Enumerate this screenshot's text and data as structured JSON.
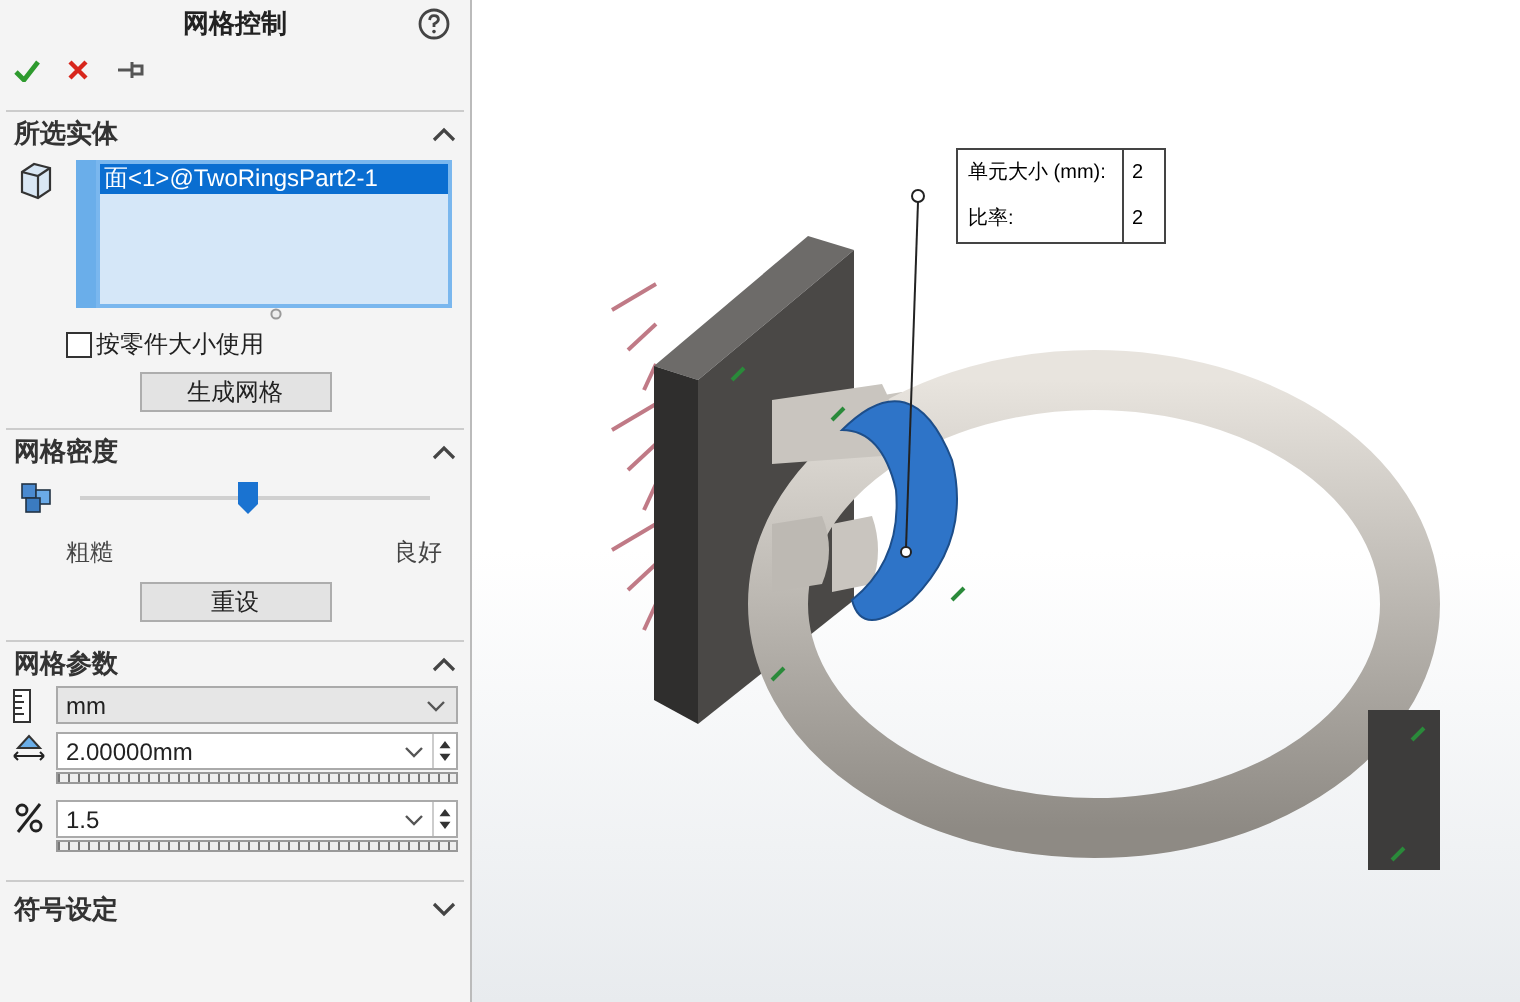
{
  "panel": {
    "title": "网格控制"
  },
  "selected_entities": {
    "title": "所选实体",
    "expanded": true,
    "items": [
      {
        "label": "面<1>@TwoRingsPart2-1",
        "selected": true
      }
    ],
    "checkbox": {
      "label": "按零件大小使用",
      "checked": false
    },
    "button": "生成网格"
  },
  "mesh_density": {
    "title": "网格密度",
    "expanded": true,
    "level": 0.48,
    "min_label": "粗糙",
    "max_label": "良好",
    "button": "重设"
  },
  "mesh_parameters": {
    "title": "网格参数",
    "expanded": true,
    "unit": {
      "value": "mm"
    },
    "element_size": {
      "value": "2.00000mm"
    },
    "ratio": {
      "value": "1.5"
    }
  },
  "symbol_settings": {
    "title": "符号设定",
    "expanded": false
  },
  "callout": {
    "rows": [
      {
        "label": "单元大小 (mm):",
        "value": "2"
      },
      {
        "label": "比率:",
        "value": "2"
      }
    ]
  }
}
